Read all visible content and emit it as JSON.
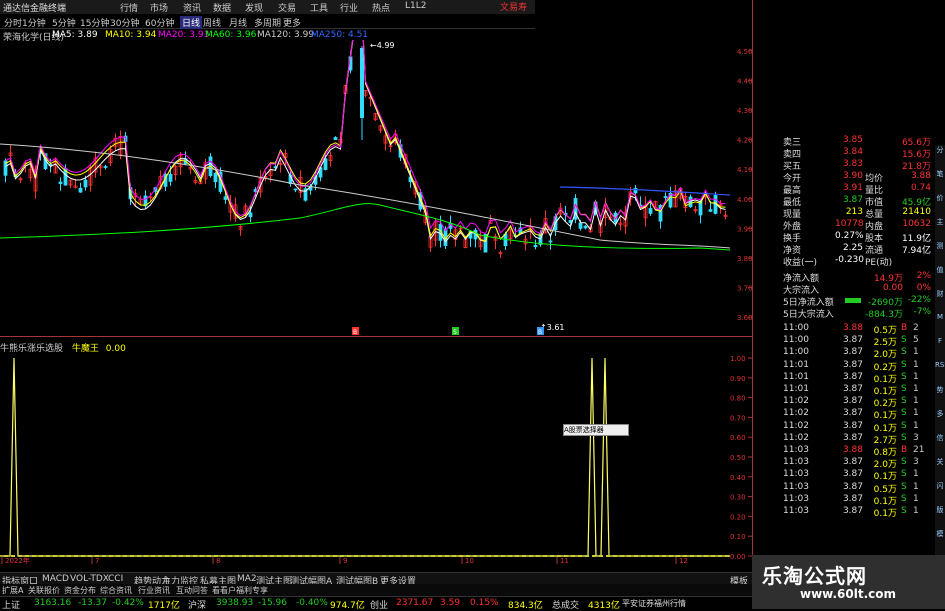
{
  "window": {
    "title": "通达信金融终端",
    "brand": "文易寿"
  },
  "menu": [
    "行情",
    "市场",
    "资讯",
    "数据",
    "发现",
    "交易",
    "工具",
    "行业",
    "热点",
    "L1L2"
  ],
  "toolbar": [
    "分时",
    "1分钟",
    "5分钟",
    "15分钟",
    "30分钟",
    "60分钟",
    "日线",
    "周线",
    "月线",
    "多周期",
    "更多"
  ],
  "toolbar_selected": 6,
  "ma_legend": {
    "stock": "荣海化学(日线)",
    "items": [
      {
        "label": "MA5: 3.89",
        "color": "#ffffff"
      },
      {
        "label": "MA10: 3.94",
        "color": "#ffff00"
      },
      {
        "label": "MA20: 3.93",
        "color": "#ff00ff"
      },
      {
        "label": "MA60: 3.96",
        "color": "#00ff00"
      },
      {
        "label": "MA120: 3.99",
        "color": "#cccccc"
      },
      {
        "label": "MA250: 4.51",
        "color": "#3366ff"
      }
    ]
  },
  "price_axis": [
    "4.50",
    "4.40",
    "4.30",
    "4.20",
    "4.10",
    "4.00",
    "3.90",
    "3.80",
    "3.70",
    "3.60"
  ],
  "annotations": {
    "high": "4.99",
    "low": "3.61",
    "markers": [
      "B",
      "S",
      "B"
    ]
  },
  "indicator_legend": {
    "title": "牛熊乐涨乐选股",
    "name": "牛魔王",
    "value": "0.00"
  },
  "indicator_axis": [
    "1.00",
    "0.90",
    "0.80",
    "0.70",
    "0.60",
    "0.50",
    "0.40",
    "0.30",
    "0.20",
    "0.10",
    "0.00"
  ],
  "date_labels": [
    "2022年",
    "7",
    "8",
    "9",
    "10",
    "11",
    "12"
  ],
  "tooltip": "A股票选择器",
  "quote": {
    "rows": [
      {
        "l": "卖三",
        "v": "3.85",
        "l2": "",
        "v2": "65.6万",
        "vc": "red"
      },
      {
        "l": "卖四",
        "v": "3.84",
        "l2": "",
        "v2": "15.6万",
        "vc": "red"
      },
      {
        "l": "买五",
        "v": "3.83",
        "l2": "",
        "v2": "21.8万",
        "vc": "red"
      },
      {
        "l": "今开",
        "v": "3.90",
        "l2": "均价",
        "v2": "3.88",
        "vc": "red"
      },
      {
        "l": "最高",
        "v": "3.91",
        "l2": "量比",
        "v2": "0.74",
        "vc": "red"
      },
      {
        "l": "最低",
        "v": "3.87",
        "l2": "市值",
        "v2": "45.9亿",
        "vc": "grn"
      },
      {
        "l": "现量",
        "v": "213",
        "l2": "总量",
        "v2": "21410",
        "vc": "yel"
      },
      {
        "l": "外盘",
        "v": "10778",
        "l2": "内盘",
        "v2": "10632",
        "vc": "red"
      },
      {
        "l": "换手",
        "v": "0.27%",
        "l2": "股本",
        "v2": "11.9亿",
        "vc": "wht"
      },
      {
        "l": "净资",
        "v": "2.25",
        "l2": "流通",
        "v2": "7.94亿",
        "vc": "wht"
      },
      {
        "l": "收益(一)",
        "v": "-0.230",
        "l2": "PE(动)",
        "v2": "",
        "vc": "wht"
      }
    ],
    "flows": [
      {
        "l": "净流入额",
        "v": "14.9万",
        "p": "2%"
      },
      {
        "l": "大宗流入",
        "v": "0.00",
        "p": "0%"
      },
      {
        "l": "5日净流入额",
        "v": "-2690万",
        "p": "-22%"
      },
      {
        "l": "5日大宗流入",
        "v": "-884.3万",
        "p": "-7%"
      }
    ],
    "ticks": [
      {
        "t": "11:00",
        "p": "3.88",
        "v": "0.5万",
        "b": "B",
        "n": "2"
      },
      {
        "t": "11:00",
        "p": "3.87",
        "v": "2.5万",
        "b": "S",
        "n": "5"
      },
      {
        "t": "11:00",
        "p": "3.87",
        "v": "2.0万",
        "b": "S",
        "n": "1"
      },
      {
        "t": "11:01",
        "p": "3.87",
        "v": "0.2万",
        "b": "S",
        "n": "1"
      },
      {
        "t": "11:01",
        "p": "3.87",
        "v": "0.1万",
        "b": "S",
        "n": "1"
      },
      {
        "t": "11:01",
        "p": "3.87",
        "v": "0.1万",
        "b": "S",
        "n": "1"
      },
      {
        "t": "11:02",
        "p": "3.87",
        "v": "0.2万",
        "b": "S",
        "n": "1"
      },
      {
        "t": "11:02",
        "p": "3.87",
        "v": "0.1万",
        "b": "S",
        "n": "1"
      },
      {
        "t": "11:02",
        "p": "3.87",
        "v": "0.1万",
        "b": "S",
        "n": "1"
      },
      {
        "t": "11:02",
        "p": "3.87",
        "v": "2.7万",
        "b": "S",
        "n": "3"
      },
      {
        "t": "11:03",
        "p": "3.88",
        "v": "0.8万",
        "b": "B",
        "n": "21"
      },
      {
        "t": "11:03",
        "p": "3.87",
        "v": "2.0万",
        "b": "S",
        "n": "3"
      },
      {
        "t": "11:03",
        "p": "3.87",
        "v": "0.1万",
        "b": "S",
        "n": "1"
      },
      {
        "t": "11:03",
        "p": "3.87",
        "v": "0.5万",
        "b": "S",
        "n": "1"
      },
      {
        "t": "11:03",
        "p": "3.87",
        "v": "0.1万",
        "b": "S",
        "n": "1"
      },
      {
        "t": "11:03",
        "p": "3.87",
        "v": "0.1万",
        "b": "S",
        "n": "1"
      }
    ]
  },
  "bottom_tabs": [
    "指标",
    "窗口",
    "MACD",
    "VOL-TDX",
    "CCI",
    "趋势动力",
    "主力监控",
    "私募主图",
    "MA2",
    "测试主图",
    "测试幅图A",
    "测试幅图B",
    "更多",
    "设置"
  ],
  "bottom_tabs2": [
    "扩展A",
    "关联报价",
    "资金分布",
    "综合资讯",
    "行业资讯",
    "互动问答",
    "看看户福利专享"
  ],
  "right_corner_label": "模板",
  "index_bar": [
    {
      "name": "上证",
      "val": "3163.16",
      "chg": "-13.37",
      "pct": "-0.42%",
      "amt": "1717亿"
    },
    {
      "name": "沪深",
      "val": "3938.93",
      "chg": "-15.96",
      "pct": "-0.40%",
      "amt": "974.7亿"
    },
    {
      "name": "创业",
      "val": "2371.67",
      "chg": "3.59",
      "pct": "0.15%",
      "amt": "834.3亿"
    },
    {
      "name": "总成交",
      "val": "4313亿",
      "chg": "",
      "pct": "",
      "amt": ""
    }
  ],
  "index_tail": "平安证券福州行情",
  "watermark": {
    "title": "乐淘公式网",
    "url": "www.60lt.com"
  },
  "sidebar_labels": [
    "分",
    "笔",
    "价",
    "主",
    "测",
    "值",
    "财",
    "M",
    "F",
    "RSI",
    "势",
    "多",
    "信",
    "关",
    "闪",
    "版",
    "模"
  ]
}
